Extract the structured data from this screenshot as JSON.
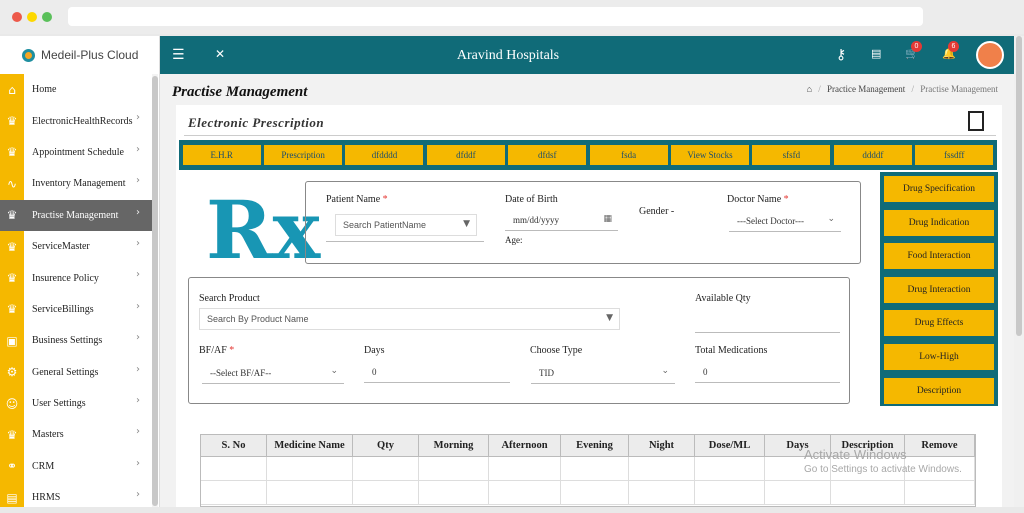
{
  "sidebar": {
    "brand": "Medeil-Plus Cloud",
    "items": [
      {
        "label": "Home",
        "icon": "⌂",
        "chevron": false
      },
      {
        "label": "ElectronicHealthRecords",
        "icon": "♛",
        "chevron": true
      },
      {
        "label": "Appointment Schedule",
        "icon": "♛",
        "chevron": true
      },
      {
        "label": "Inventory Management",
        "icon": "∿",
        "chevron": true
      },
      {
        "label": "Practise Management",
        "icon": "♛",
        "chevron": true,
        "active": true
      },
      {
        "label": "ServiceMaster",
        "icon": "♛",
        "chevron": true
      },
      {
        "label": "Insurence Policy",
        "icon": "♛",
        "chevron": true
      },
      {
        "label": "ServiceBillings",
        "icon": "♛",
        "chevron": true
      },
      {
        "label": "Business Settings",
        "icon": "▣",
        "chevron": true
      },
      {
        "label": "General Settings",
        "icon": "⚙",
        "chevron": true
      },
      {
        "label": "User Settings",
        "icon": "☺",
        "chevron": true
      },
      {
        "label": "Masters",
        "icon": "♛",
        "chevron": true
      },
      {
        "label": "CRM",
        "icon": "⚭",
        "chevron": true
      },
      {
        "label": "HRMS",
        "icon": "▤",
        "chevron": true
      }
    ]
  },
  "topbar": {
    "hospital": "Aravind Hospitals",
    "menu_icon": "☰",
    "expand_icon": "✕",
    "key_icon": "⚷",
    "file_icon": "▤",
    "cart_icon": "🛒",
    "bell_icon": "🔔",
    "cart_badge": "0",
    "bell_badge": "6"
  },
  "page": {
    "title": "Practise Management",
    "breadcrumb_home": "⌂",
    "breadcrumb_sep": "/",
    "breadcrumb_1": "Practice Management",
    "breadcrumb_2": "Practise Management"
  },
  "card": {
    "title": "Electronic Prescription",
    "tabs": [
      "E.H.R",
      "Prescription",
      "dfdddd",
      "dfddf",
      "dfdsf",
      "fsda",
      "View Stocks",
      "sfsfd",
      "ddddf",
      "fssdff"
    ]
  },
  "rx_logo": "Rx",
  "form": {
    "patient_label": "Patient Name",
    "patient_placeholder": "Search PatientName",
    "dob_label": "Date of Birth",
    "dob_value": "mm/dd/yyyy",
    "age_label": "Age:",
    "gender_label": "Gender -",
    "doctor_label": "Doctor Name",
    "doctor_value": "---Select Doctor---",
    "search_product_label": "Search Product",
    "search_product_placeholder": "Search By Product Name",
    "available_qty_label": "Available Qty",
    "bfaf_label": "BF/AF",
    "bfaf_value": "--Select BF/AF--",
    "days_label": "Days",
    "days_value": "0",
    "choose_type_label": "Choose Type",
    "choose_type_value": "TID",
    "total_med_label": "Total Medications",
    "total_med_value": "0",
    "required_mark": "*"
  },
  "side_buttons": [
    "Drug Specification",
    "Drug Indication",
    "Food Interaction",
    "Drug Interaction",
    "Drug Effects",
    "Low-High",
    "Description"
  ],
  "table": {
    "headers": [
      "S. No",
      "Medicine Name",
      "Qty",
      "Morning",
      "Afternoon",
      "Evening",
      "Night",
      "Dose/ML",
      "Days",
      "Description",
      "Remove"
    ]
  },
  "watermark": {
    "line1": "Activate Windows",
    "line2": "Go to Settings to activate Windows."
  },
  "colors": {
    "teal": "#106b78",
    "yellow": "#f5b800",
    "rx_blue": "#1896b4"
  }
}
